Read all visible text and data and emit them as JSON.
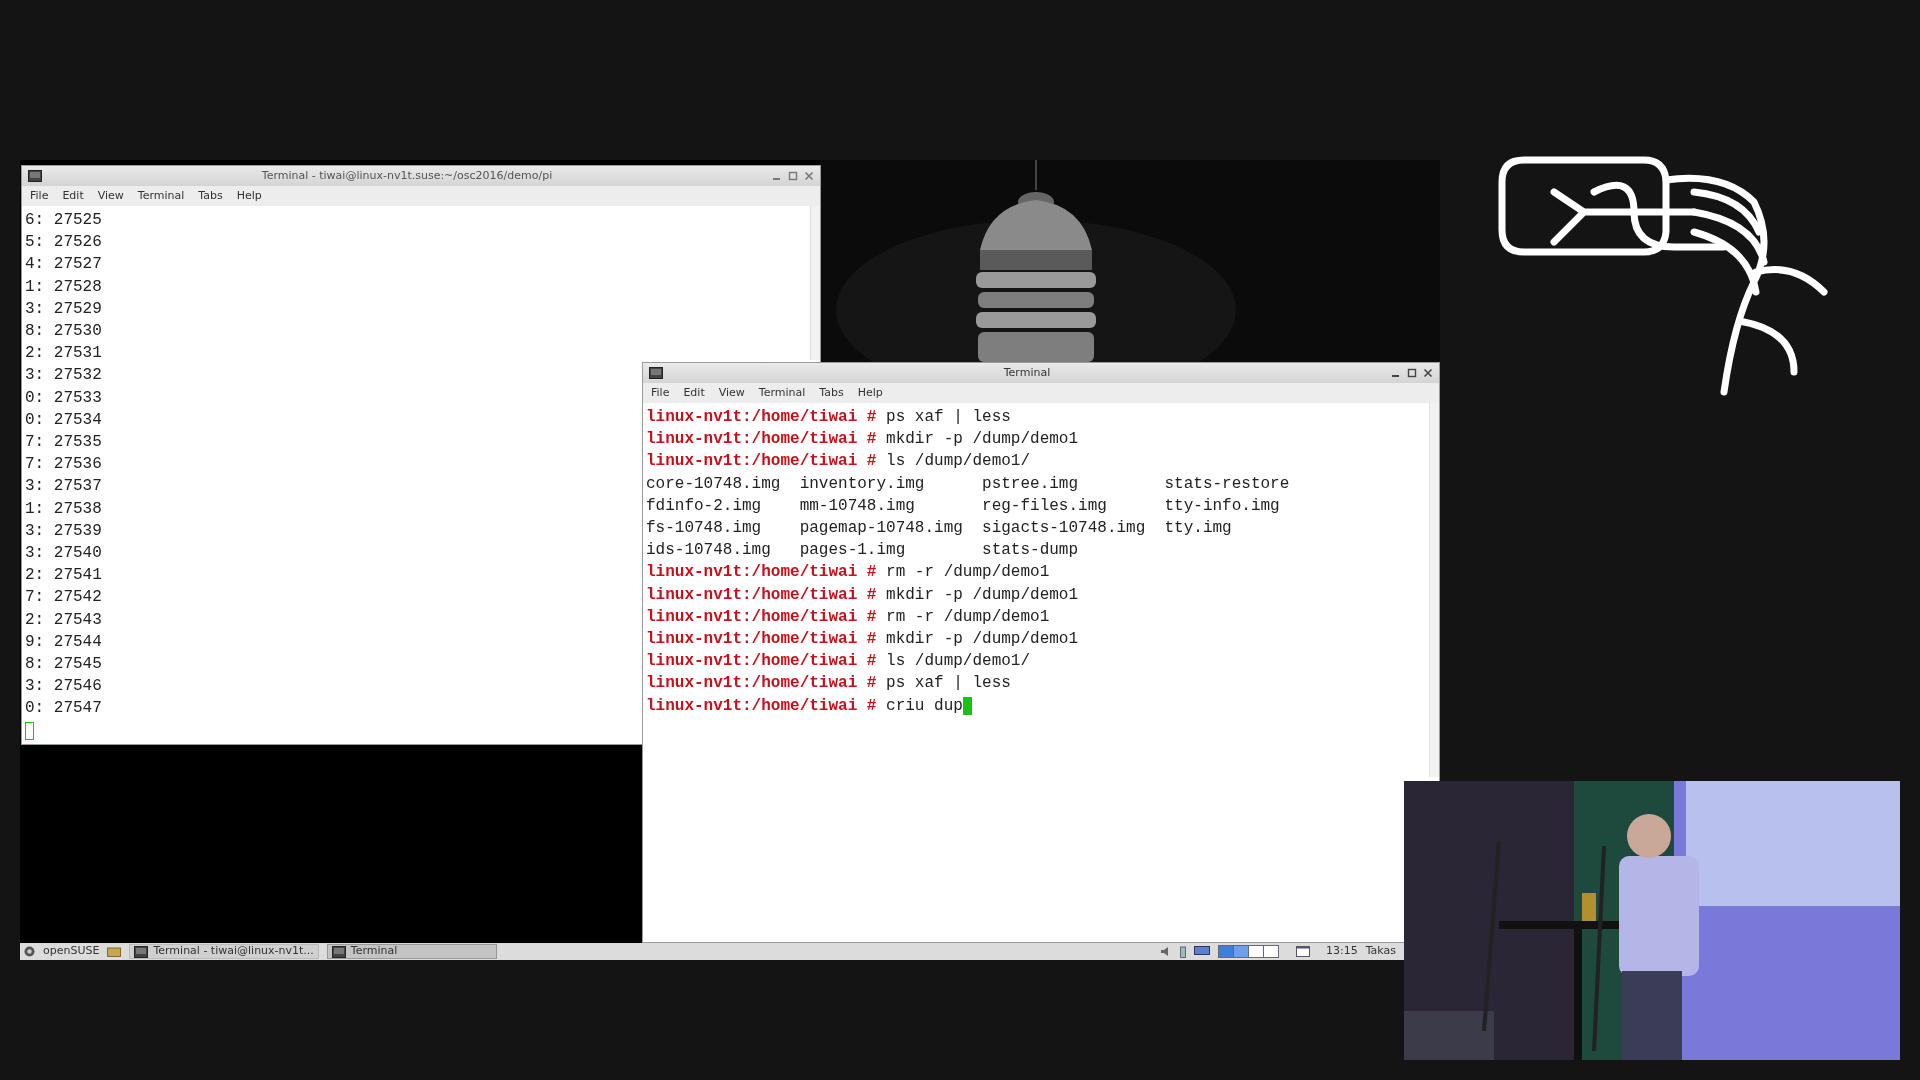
{
  "left_terminal": {
    "title": "Terminal - tiwai@linux-nv1t.suse:~/osc2016/demo/pi",
    "focused": false,
    "menu": [
      "File",
      "Edit",
      "View",
      "Terminal",
      "Tabs",
      "Help"
    ],
    "lines": [
      "6: 27525",
      "5: 27526",
      "4: 27527",
      "1: 27528",
      "3: 27529",
      "8: 27530",
      "2: 27531",
      "3: 27532",
      "0: 27533",
      "0: 27534",
      "7: 27535",
      "7: 27536",
      "3: 27537",
      "1: 27538",
      "3: 27539",
      "3: 27540",
      "2: 27541",
      "7: 27542",
      "2: 27543",
      "9: 27544",
      "8: 27545",
      "3: 27546",
      "0: 27547"
    ]
  },
  "right_terminal": {
    "title": "Terminal",
    "focused": true,
    "menu": [
      "File",
      "Edit",
      "View",
      "Terminal",
      "Tabs",
      "Help"
    ],
    "lines": [
      {
        "kind": "prompt",
        "prompt": "linux-nv1t:/home/tiwai #",
        "command": "ps xaf | less"
      },
      {
        "kind": "prompt",
        "prompt": "linux-nv1t:/home/tiwai #",
        "command": "mkdir -p /dump/demo1"
      },
      {
        "kind": "prompt",
        "prompt": "linux-nv1t:/home/tiwai #",
        "command": "ls /dump/demo1/"
      },
      {
        "kind": "output",
        "text": "core-10748.img  inventory.img      pstree.img         stats-restore"
      },
      {
        "kind": "output",
        "text": "fdinfo-2.img    mm-10748.img       reg-files.img      tty-info.img"
      },
      {
        "kind": "output",
        "text": "fs-10748.img    pagemap-10748.img  sigacts-10748.img  tty.img"
      },
      {
        "kind": "output",
        "text": "ids-10748.img   pages-1.img        stats-dump"
      },
      {
        "kind": "prompt",
        "prompt": "linux-nv1t:/home/tiwai #",
        "command": "rm -r /dump/demo1"
      },
      {
        "kind": "prompt",
        "prompt": "linux-nv1t:/home/tiwai #",
        "command": "mkdir -p /dump/demo1"
      },
      {
        "kind": "prompt",
        "prompt": "linux-nv1t:/home/tiwai #",
        "command": "rm -r /dump/demo1"
      },
      {
        "kind": "prompt",
        "prompt": "linux-nv1t:/home/tiwai #",
        "command": "mkdir -p /dump/demo1"
      },
      {
        "kind": "prompt",
        "prompt": "linux-nv1t:/home/tiwai #",
        "command": "ls /dump/demo1/"
      },
      {
        "kind": "prompt",
        "prompt": "linux-nv1t:/home/tiwai #",
        "command": "ps xaf | less"
      },
      {
        "kind": "prompt",
        "prompt": "linux-nv1t:/home/tiwai #",
        "command": "criu dup"
      }
    ]
  },
  "taskbar": {
    "start": "openSUSE",
    "tasks": [
      {
        "label": "Terminal - tiwai@linux-nv1t...",
        "selected": false
      },
      {
        "label": "Terminal",
        "selected": true
      }
    ],
    "clock": "13:15",
    "user": "Takas"
  }
}
